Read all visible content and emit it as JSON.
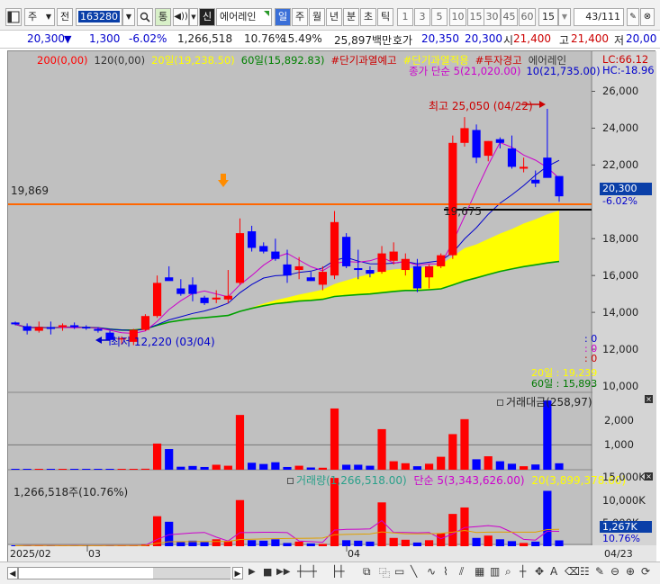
{
  "toolbar": {
    "type_select": "주",
    "prefix_button": "전",
    "code": "163280",
    "period_toggle": "통",
    "sin_badge": "신",
    "stock_name": "에어레인",
    "period_tabs": [
      "일",
      "주",
      "월",
      "년",
      "분",
      "초",
      "틱"
    ],
    "interval_buttons": [
      "1",
      "3",
      "5",
      "10",
      "15",
      "30",
      "45",
      "60"
    ],
    "interval_value": "15",
    "page_counter": "43/111"
  },
  "info": {
    "price": "20,300",
    "arrow": "▼",
    "change": "1,300",
    "change_pct": "-6.02%",
    "volume": "1,266,518",
    "turnover_pct": "10.76%",
    "ratio_pct": "15.49%",
    "amount": "25,897백만",
    "quote_label": "호가",
    "ask": "20,350",
    "bid": "20,300",
    "open_label": "시",
    "open": "21,400",
    "high_label": "고",
    "high": "21,400",
    "low_label": "저",
    "low": "20,00"
  },
  "legend": {
    "line1": [
      {
        "text": "200(0,00)",
        "color": "#ff0000"
      },
      {
        "text": "120(0,00)",
        "color": "#333333"
      },
      {
        "text": "20일(19,238.50)",
        "color": "#ffff00"
      },
      {
        "text": "60일(15,892.83)",
        "color": "#008000"
      },
      {
        "text": "#단기과열예고",
        "color": "#cc0000"
      },
      {
        "text": "#단기과열적용",
        "color": "#ffff00"
      },
      {
        "text": "#투자경고",
        "color": "#cc0000"
      },
      {
        "text": "에어레인",
        "color": "#333333"
      }
    ],
    "line2": [
      {
        "text": "종가 단순 5(21,020.00)",
        "color": "#cc00cc"
      },
      {
        "text": "10(21,735.00)",
        "color": "#0000cc"
      }
    ],
    "lc": "LC:66.12",
    "hc": "HC:-18.96"
  },
  "annotations": {
    "high_note": "최고 25,050 (04/22)",
    "low_note": "최저 12,220 (03/04)",
    "hline_value": "19,869",
    "level_label": "19,675",
    "current_price_tag": "20,300",
    "current_pct_tag": "-6.02%",
    "zero_labels": [
      "0",
      "0",
      "0"
    ],
    "ma20_label": "20일 : 19,239",
    "ma60_label": "60일 : 15,893"
  },
  "price_axis": [
    "26,000",
    "24,000",
    "22,000",
    "20,000",
    "18,000",
    "16,000",
    "14,000",
    "12,000",
    "10,000"
  ],
  "amount_panel": {
    "title": "거래대금(258,97)",
    "axis": [
      "2,000",
      "1,000"
    ]
  },
  "volume_panel": {
    "title_vol": "거래량(1,266,518.00)",
    "title_ma5": "단순 5(3,343,626.00)",
    "title_ma20": "20(3,899,378.60)",
    "left_label": "1,266,518주(10.76%)",
    "axis": [
      "15,000K",
      "10,000K",
      "5,000K"
    ],
    "current_tag": "1,267K",
    "current_pct": "10.76%"
  },
  "date_axis": [
    "2025/02",
    "03",
    "04"
  ],
  "date_right": "04/23",
  "colors": {
    "up": "#ff0000",
    "down": "#0000ff",
    "band": "#ffff00",
    "hline": "#ff6600",
    "ma60": "#00a000",
    "ma10": "#0000cc",
    "ma5": "#cc00cc"
  },
  "chart_data": {
    "type": "candlestick",
    "dates": [
      "02-17",
      "02-18",
      "02-19",
      "02-20",
      "02-21",
      "02-24",
      "02-25",
      "02-26",
      "02-27",
      "02-28",
      "03-04",
      "03-05",
      "03-06",
      "03-07",
      "03-10",
      "03-11",
      "03-12",
      "03-13",
      "03-14",
      "03-17",
      "03-18",
      "03-19",
      "03-20",
      "03-21",
      "03-24",
      "03-25",
      "03-26",
      "03-27",
      "03-28",
      "03-31",
      "04-01",
      "04-02",
      "04-03",
      "04-04",
      "04-07",
      "04-08",
      "04-09",
      "04-10",
      "04-11",
      "04-14",
      "04-15",
      "04-16",
      "04-17",
      "04-18",
      "04-21",
      "04-22",
      "04-23"
    ],
    "ohlc": [
      [
        13450,
        13500,
        13300,
        13350
      ],
      [
        13250,
        13400,
        12800,
        13000
      ],
      [
        13000,
        13500,
        12900,
        13200
      ],
      [
        13200,
        13500,
        12800,
        13100
      ],
      [
        13200,
        13400,
        13000,
        13300
      ],
      [
        13300,
        13450,
        13100,
        13200
      ],
      [
        13200,
        13300,
        13050,
        13150
      ],
      [
        13100,
        13200,
        12900,
        13000
      ],
      [
        12900,
        13000,
        12200,
        12500
      ],
      [
        12550,
        12700,
        12250,
        12600
      ],
      [
        12400,
        13100,
        12220,
        13050
      ],
      [
        13050,
        13900,
        13000,
        13800
      ],
      [
        13800,
        16000,
        13700,
        15600
      ],
      [
        15900,
        16500,
        15800,
        15700
      ],
      [
        15300,
        15800,
        14900,
        15000
      ],
      [
        15500,
        15900,
        14600,
        15000
      ],
      [
        14800,
        14900,
        14400,
        14500
      ],
      [
        14700,
        15200,
        14500,
        14800
      ],
      [
        14700,
        16300,
        14500,
        14900
      ],
      [
        15600,
        19100,
        15500,
        18300
      ],
      [
        18400,
        18700,
        17300,
        17500
      ],
      [
        17600,
        17800,
        17200,
        17300
      ],
      [
        17300,
        18000,
        16800,
        16900
      ],
      [
        16600,
        17400,
        15600,
        16000
      ],
      [
        16300,
        17000,
        15800,
        16500
      ],
      [
        15900,
        16200,
        15700,
        15700
      ],
      [
        15500,
        16500,
        15200,
        16200
      ],
      [
        16000,
        19500,
        15800,
        18900
      ],
      [
        18100,
        18300,
        16400,
        16500
      ],
      [
        16400,
        17400,
        15800,
        16300
      ],
      [
        16300,
        16500,
        15900,
        16100
      ],
      [
        16200,
        17600,
        16100,
        17200
      ],
      [
        16800,
        17800,
        16600,
        17300
      ],
      [
        16300,
        17200,
        16000,
        16900
      ],
      [
        16500,
        16900,
        15100,
        15300
      ],
      [
        15900,
        16600,
        15300,
        16500
      ],
      [
        16500,
        17200,
        16400,
        17100
      ],
      [
        17100,
        23600,
        16900,
        23200
      ],
      [
        23200,
        24600,
        23000,
        24000
      ],
      [
        23900,
        24200,
        22100,
        22400
      ],
      [
        22500,
        23300,
        22200,
        23300
      ],
      [
        23400,
        23500,
        22900,
        23200
      ],
      [
        22900,
        23600,
        21800,
        21900
      ],
      [
        21800,
        22400,
        21600,
        21900
      ],
      [
        21200,
        21700,
        20800,
        21000
      ],
      [
        22400,
        25050,
        21400,
        21300
      ],
      [
        21400,
        21400,
        20000,
        20300
      ]
    ],
    "amount_bil": [
      10,
      15,
      12,
      10,
      8,
      20,
      10,
      12,
      18,
      10,
      25,
      40,
      1050,
      830,
      120,
      150,
      110,
      200,
      160,
      2200,
      280,
      230,
      300,
      110,
      160,
      90,
      80,
      2460,
      200,
      200,
      160,
      1630,
      340,
      260,
      140,
      240,
      520,
      1430,
      2030,
      420,
      540,
      340,
      240,
      140,
      210,
      2780,
      259
    ],
    "volume_k": [
      100,
      200,
      120,
      100,
      90,
      150,
      100,
      120,
      180,
      120,
      200,
      400,
      6500,
      5300,
      1000,
      1200,
      900,
      1500,
      1100,
      10000,
      1300,
      1200,
      1500,
      700,
      1000,
      600,
      500,
      14800,
      1300,
      1200,
      1000,
      9500,
      1800,
      1400,
      800,
      1300,
      2800,
      7000,
      8400,
      1800,
      2300,
      1500,
      1100,
      700,
      1000,
      12000,
      1267
    ],
    "hline": 19869,
    "level_label_value": 19675,
    "ylim": [
      10000,
      27000
    ],
    "amount_ylim": [
      0,
      3000
    ],
    "volume_ylim": [
      0,
      16000
    ]
  }
}
